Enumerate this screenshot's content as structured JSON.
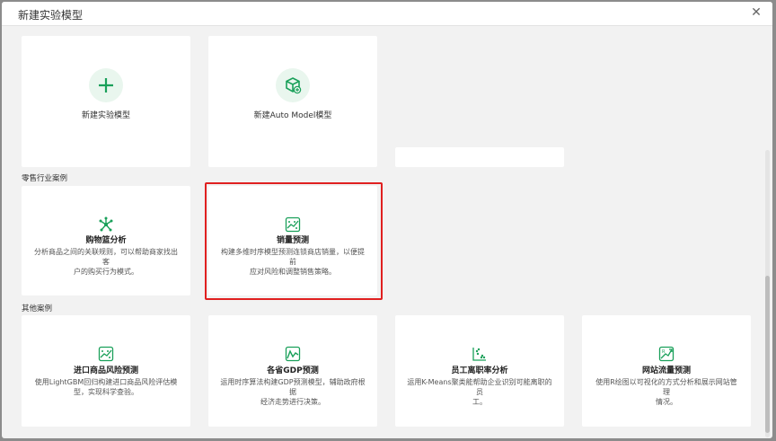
{
  "dialog": {
    "title": "新建实验模型",
    "close_symbol": "✕"
  },
  "create_cards": [
    {
      "label": "新建实验模型",
      "icon": "plus-icon"
    },
    {
      "label": "新建Auto Model模型",
      "icon": "cube-plus-icon"
    }
  ],
  "sections": {
    "retail": "零售行业案例",
    "other": "其他案例"
  },
  "retail_cases": [
    {
      "title": "购物篮分析",
      "desc_lines": [
        "分析商品之间的关联规则，可以帮助商家找出客",
        "户的购买行为模式。"
      ],
      "icon": "network-icon"
    },
    {
      "title": "销量预测",
      "desc_lines": [
        "构建多维时序模型预测连锁商店销量，以便提前",
        "应对风险和调整销售策略。"
      ],
      "icon": "chart-scatter-icon"
    }
  ],
  "other_cases": [
    {
      "title": "进口商品风险预测",
      "desc_lines": [
        "使用LightGBM回归构建进口商品风险评估模",
        "型，实现科学查验。"
      ],
      "icon": "chart-scatter-icon"
    },
    {
      "title": "各省GDP预测",
      "desc_lines": [
        "运用时序算法构建GDP预测模型，辅助政府根据",
        "经济走势进行决策。"
      ],
      "icon": "line-chart-icon"
    },
    {
      "title": "员工离职率分析",
      "desc_lines": [
        "运用K-Means聚类能帮助企业识别可能离职的员",
        "工。"
      ],
      "icon": "cluster-icon"
    },
    {
      "title": "网站流量预测",
      "desc_lines": [
        "使用R绘图以可视化的方式分析和展示网站管理",
        "情况。"
      ],
      "icon": "r-chart-icon"
    }
  ],
  "colors": {
    "accent": "#1aa05a",
    "highlight": "#e02020"
  }
}
